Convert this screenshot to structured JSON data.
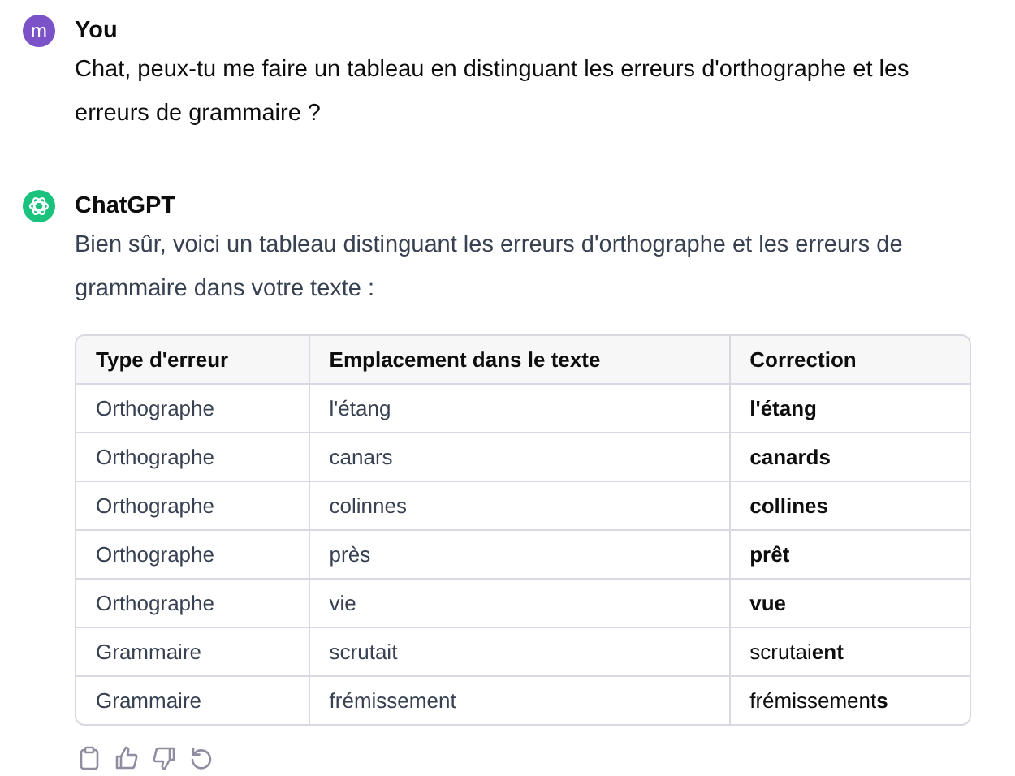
{
  "messages": [
    {
      "author": "You",
      "kind": "user",
      "text": "Chat, peux-tu me faire un tableau en distinguant les erreurs d'orthographe et les erreurs de grammaire ?"
    },
    {
      "author": "ChatGPT",
      "kind": "assistant",
      "text": "Bien sûr, voici un tableau distinguant les erreurs d'orthographe et les erreurs de grammaire dans votre texte :",
      "table": {
        "columns": [
          "Type d'erreur",
          "Emplacement dans le texte",
          "Correction"
        ],
        "rows": [
          {
            "type": "Orthographe",
            "location": "l'étang",
            "correction": "l'étang",
            "bold": true
          },
          {
            "type": "Orthographe",
            "location": "canars",
            "correction": "canards",
            "bold": true
          },
          {
            "type": "Orthographe",
            "location": "colinnes",
            "correction": "collines",
            "bold": true
          },
          {
            "type": "Orthographe",
            "location": "près",
            "correction": "prêt",
            "bold": true
          },
          {
            "type": "Orthographe",
            "location": "vie",
            "correction": "vue",
            "bold": true
          },
          {
            "type": "Grammaire",
            "location": "scrutait",
            "correction": "scrutai**ent**",
            "bold": false
          },
          {
            "type": "Grammaire",
            "location": "frémissement",
            "correction": "frémissement**s**",
            "bold": false
          }
        ]
      }
    }
  ],
  "user_avatar": "m"
}
